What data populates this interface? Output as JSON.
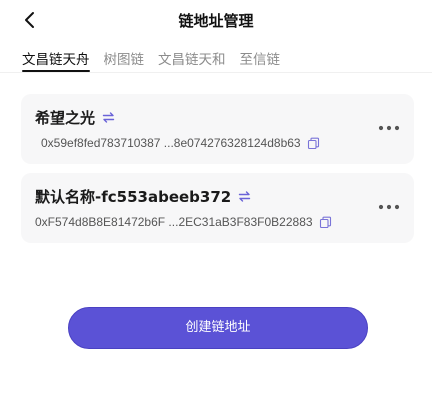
{
  "header": {
    "title": "链地址管理",
    "back_icon": "chevron-left-icon"
  },
  "tabs": [
    {
      "label": "文昌链天舟",
      "active": true
    },
    {
      "label": "树图链",
      "active": false
    },
    {
      "label": "文昌链天和",
      "active": false
    },
    {
      "label": "至信链",
      "active": false
    }
  ],
  "addresses": [
    {
      "name": "希望之光",
      "address": "0x59ef8fed783710387 ...8e074276328124d8b63",
      "switch_icon": "switch-arrows-icon",
      "copy_icon": "copy-icon",
      "more_icon": "more-dots-icon"
    },
    {
      "name": "默认名称-fc553abeeb372",
      "address": "0xF574d8B8E81472b6F ...2EC31aB3F83F0B22883",
      "switch_icon": "switch-arrows-icon",
      "copy_icon": "copy-icon",
      "more_icon": "more-dots-icon"
    }
  ],
  "create_button": {
    "label": "创建链地址"
  },
  "colors": {
    "accent": "#5b52d6",
    "icon_accent": "#6a63d8",
    "card_bg": "#f7f7f8",
    "text_primary": "#1a1a1a",
    "text_secondary": "#555555",
    "tab_inactive": "#8c8c8c"
  }
}
